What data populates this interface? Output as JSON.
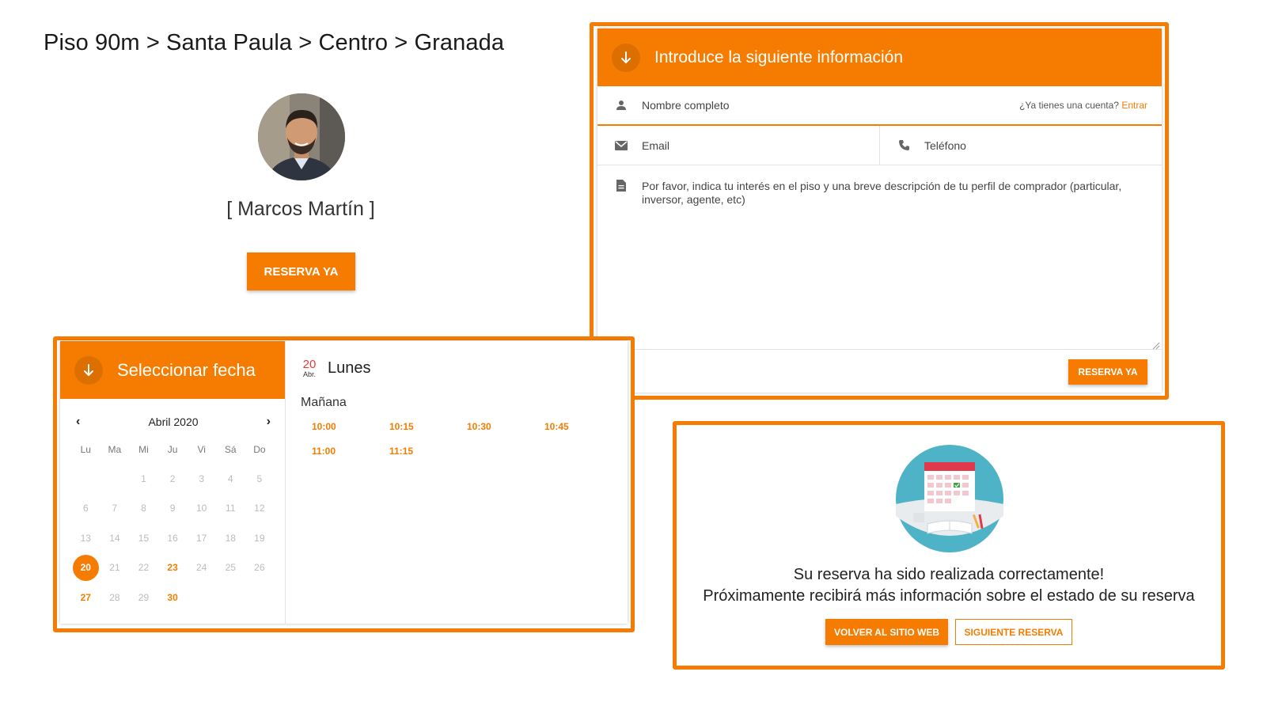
{
  "breadcrumb": "Piso 90m > Santa Paula > Centro > Granada",
  "agent": {
    "name": "[ Marcos Martín ]",
    "cta": "RESERVA YA"
  },
  "form": {
    "title": "Introduce la siguiente información",
    "name_placeholder": "Nombre completo",
    "account_question": "¿Ya tienes una cuenta?",
    "login_link": "Entrar",
    "email_placeholder": "Email",
    "phone_placeholder": "Teléfono",
    "message_placeholder": "Por favor, indica tu interés en el piso y una breve descripción de tu perfil de comprador (particular, inversor, agente, etc)",
    "submit": "RESERVA YA"
  },
  "calendar": {
    "title": "Seleccionar fecha",
    "month_label": "Abril 2020",
    "weekdays": [
      "Lu",
      "Ma",
      "Mi",
      "Ju",
      "Vi",
      "Sá",
      "Do"
    ],
    "selected": {
      "day": "20",
      "month_abbr": "Abr.",
      "weekday": "Lunes"
    },
    "period": "Mañana",
    "slots": [
      "10:00",
      "10:15",
      "10:30",
      "10:45",
      "11:00",
      "11:15"
    ]
  },
  "success": {
    "line1": "Su reserva ha sido realizada correctamente!",
    "line2": "Próximamente recibirá más información sobre el estado de su reserva",
    "back_button": "VOLVER AL SITIO WEB",
    "next_button": "SIGUIENTE RESERVA"
  },
  "colors": {
    "accent": "#f57c00",
    "date_red": "#e53935"
  }
}
